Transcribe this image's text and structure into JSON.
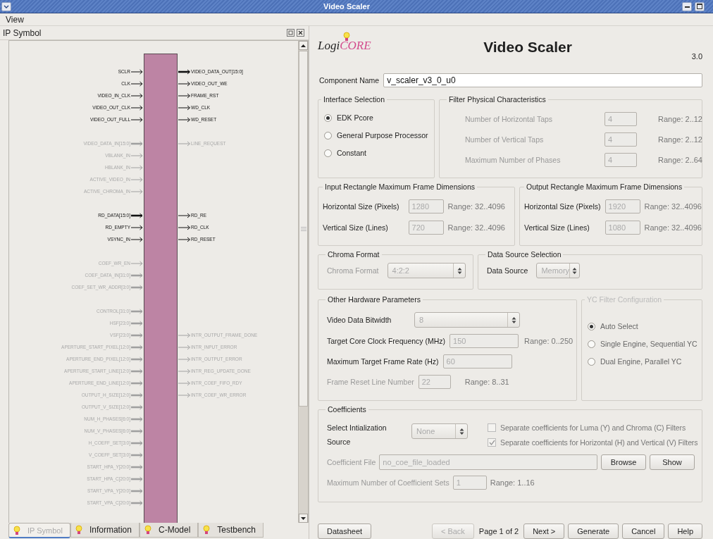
{
  "window": {
    "title": "Video Scaler"
  },
  "menu": [
    "View"
  ],
  "left_panel": {
    "title": "IP Symbol",
    "symbol": {
      "groups": [
        {
          "rows": [
            {
              "left": {
                "name": "SCLR",
                "enabled": true,
                "bus": false
              },
              "right": {
                "name": "VIDEO_DATA_OUT[15:0]",
                "enabled": true,
                "bus": true
              }
            },
            {
              "left": {
                "name": "CLK",
                "enabled": true,
                "bus": false
              },
              "right": {
                "name": "VIDEO_OUT_WE",
                "enabled": true,
                "bus": false
              }
            },
            {
              "left": {
                "name": "VIDEO_IN_CLK",
                "enabled": true,
                "bus": false
              },
              "right": {
                "name": "FRAME_RST",
                "enabled": true,
                "bus": false
              }
            },
            {
              "left": {
                "name": "VIDEO_OUT_CLK",
                "enabled": true,
                "bus": false
              },
              "right": {
                "name": "WD_CLK",
                "enabled": true,
                "bus": false
              }
            },
            {
              "left": {
                "name": "VIDEO_OUT_FULL",
                "enabled": true,
                "bus": false
              },
              "right": {
                "name": "WD_RESET",
                "enabled": true,
                "bus": false
              }
            }
          ]
        },
        {
          "rows": [
            {
              "left": {
                "name": "VIDEO_DATA_IN[15:0]",
                "enabled": false,
                "bus": true
              },
              "right": {
                "name": "LINE_REQUEST",
                "enabled": false,
                "bus": false
              }
            },
            {
              "left": {
                "name": "VBLANK_IN",
                "enabled": false,
                "bus": false
              }
            },
            {
              "left": {
                "name": "HBLANK_IN",
                "enabled": false,
                "bus": false
              }
            },
            {
              "left": {
                "name": "ACTIVE_VIDEO_IN",
                "enabled": false,
                "bus": false
              }
            },
            {
              "left": {
                "name": "ACTIVE_CHROMA_IN",
                "enabled": false,
                "bus": false
              }
            }
          ]
        },
        {
          "rows": [
            {
              "left": {
                "name": "RD_DATA[15:0]",
                "enabled": true,
                "bus": true
              },
              "right": {
                "name": "RD_RE",
                "enabled": true,
                "bus": false
              }
            },
            {
              "left": {
                "name": "RD_EMPTY",
                "enabled": true,
                "bus": false
              },
              "right": {
                "name": "RD_CLK",
                "enabled": true,
                "bus": false
              }
            },
            {
              "left": {
                "name": "VSYNC_IN",
                "enabled": true,
                "bus": false
              },
              "right": {
                "name": "RD_RESET",
                "enabled": true,
                "bus": false
              }
            }
          ]
        },
        {
          "rows": [
            {
              "left": {
                "name": "COEF_WR_EN",
                "enabled": false,
                "bus": false
              }
            },
            {
              "left": {
                "name": "COEF_DATA_IN[31:0]",
                "enabled": false,
                "bus": true
              }
            },
            {
              "left": {
                "name": "COEF_SET_WR_ADDR[3:0]",
                "enabled": false,
                "bus": true
              }
            }
          ]
        },
        {
          "rows": [
            {
              "left": {
                "name": "CONTROL[31:0]",
                "enabled": false,
                "bus": true
              }
            },
            {
              "left": {
                "name": "HSF[23:0]",
                "enabled": false,
                "bus": true
              }
            },
            {
              "left": {
                "name": "VSF[23:0]",
                "enabled": false,
                "bus": true
              },
              "right": {
                "name": "INTR_OUTPUT_FRAME_DONE",
                "enabled": false,
                "bus": false
              }
            },
            {
              "left": {
                "name": "APERTURE_START_PIXEL[12:0]",
                "enabled": false,
                "bus": true
              },
              "right": {
                "name": "INTR_INPUT_ERROR",
                "enabled": false,
                "bus": false
              }
            },
            {
              "left": {
                "name": "APERTURE_END_PIXEL[12:0]",
                "enabled": false,
                "bus": true
              },
              "right": {
                "name": "INTR_OUTPUT_ERROR",
                "enabled": false,
                "bus": false
              }
            },
            {
              "left": {
                "name": "APERTURE_START_LINE[12:0]",
                "enabled": false,
                "bus": true
              },
              "right": {
                "name": "INTR_REG_UPDATE_DONE",
                "enabled": false,
                "bus": false
              }
            },
            {
              "left": {
                "name": "APERTURE_END_LINE[12:0]",
                "enabled": false,
                "bus": true
              },
              "right": {
                "name": "INTR_COEF_FIFO_RDY",
                "enabled": false,
                "bus": false
              }
            },
            {
              "left": {
                "name": "OUTPUT_H_SIZE[12:0]",
                "enabled": false,
                "bus": true
              },
              "right": {
                "name": "INTR_COEF_WR_ERROR",
                "enabled": false,
                "bus": false
              }
            },
            {
              "left": {
                "name": "OUTPUT_V_SIZE[12:0]",
                "enabled": false,
                "bus": true
              }
            },
            {
              "left": {
                "name": "NUM_H_PHASES[6:0]",
                "enabled": false,
                "bus": true
              }
            },
            {
              "left": {
                "name": "NUM_V_PHASES[6:0]",
                "enabled": false,
                "bus": true
              }
            },
            {
              "left": {
                "name": "H_COEFF_SET[3:0]",
                "enabled": false,
                "bus": true
              }
            },
            {
              "left": {
                "name": "V_COEFF_SET[3:0]",
                "enabled": false,
                "bus": true
              }
            },
            {
              "left": {
                "name": "START_HPA_Y[20:0]",
                "enabled": false,
                "bus": true
              }
            },
            {
              "left": {
                "name": "START_HPA_C[20:0]",
                "enabled": false,
                "bus": true
              }
            },
            {
              "left": {
                "name": "START_VPA_Y[20:0]",
                "enabled": false,
                "bus": true
              }
            },
            {
              "left": {
                "name": "START_VPA_C[20:0]",
                "enabled": false,
                "bus": true
              }
            }
          ]
        }
      ]
    },
    "tabs": [
      {
        "label": "IP Symbol",
        "selected": true
      },
      {
        "label": "Information",
        "selected": false
      },
      {
        "label": "C-Model",
        "selected": false
      },
      {
        "label": "Testbench",
        "selected": false
      }
    ]
  },
  "header": {
    "logo": {
      "prefix": "Logi",
      "suffix": "CORE"
    },
    "title": "Video Scaler",
    "version": "3.0"
  },
  "component_name": {
    "label": "Component Name",
    "value": "v_scaler_v3_0_u0"
  },
  "interface_selection": {
    "title": "Interface Selection",
    "options": [
      {
        "label": "EDK Pcore",
        "selected": true
      },
      {
        "label": "General Purpose Processor",
        "selected": false
      },
      {
        "label": "Constant",
        "selected": false
      }
    ]
  },
  "filter": {
    "title": "Filter Physical Characteristics",
    "fields": [
      {
        "label": "Number of Horizontal Taps",
        "value": "4",
        "range": "Range: 2..12",
        "disabled": true
      },
      {
        "label": "Number of Vertical Taps",
        "value": "4",
        "range": "Range: 2..12",
        "disabled": true
      },
      {
        "label": "Maximum Number of Phases",
        "value": "4",
        "range": "Range: 2..64",
        "disabled": true
      }
    ]
  },
  "input_rect": {
    "title": "Input Rectangle Maximum Frame Dimensions",
    "fields": [
      {
        "label": "Horizontal Size (Pixels)",
        "value": "1280",
        "range": "Range: 32..4096",
        "disabled": false
      },
      {
        "label": "Vertical Size (Lines)",
        "value": "720",
        "range": "Range: 32..4096",
        "disabled": false
      }
    ]
  },
  "output_rect": {
    "title": "Output Rectangle Maximum Frame Dimensions",
    "fields": [
      {
        "label": "Horizontal Size (Pixels)",
        "value": "1920",
        "range": "Range: 32..4096",
        "disabled": false
      },
      {
        "label": "Vertical Size (Lines)",
        "value": "1080",
        "range": "Range: 32..4096",
        "disabled": false
      }
    ]
  },
  "chroma": {
    "title": "Chroma Format",
    "fields": [
      {
        "kind": "select",
        "label": "Chroma Format",
        "value": "4:2:2",
        "disabled": true
      }
    ]
  },
  "data_source": {
    "title": "Data Source Selection",
    "fields": [
      {
        "kind": "select",
        "label": "Data Source",
        "value": "Memory",
        "disabled": false
      }
    ]
  },
  "hardware": {
    "title": "Other Hardware Parameters",
    "fields": [
      {
        "kind": "select",
        "label": "Video Data Bitwidth",
        "value": "8",
        "disabled": false
      },
      {
        "kind": "text",
        "label": "Target Core Clock Frequency (MHz)",
        "value": "150",
        "range": "Range: 0..250",
        "disabled": false
      },
      {
        "kind": "text",
        "label": "Maximum Target Frame Rate (Hz)",
        "value": "60",
        "disabled": false
      },
      {
        "kind": "text",
        "label": "Frame Reset Line Number",
        "value": "22",
        "range": "Range: 8..31",
        "disabled": true
      }
    ]
  },
  "yc_filter": {
    "title": "YC Filter Configuration",
    "disabled": true,
    "options": [
      {
        "label": "Auto Select",
        "selected": true
      },
      {
        "label": "Single Engine, Sequential YC",
        "selected": false
      },
      {
        "label": "Dual Engine, Parallel YC",
        "selected": false
      }
    ]
  },
  "coefficients": {
    "title": "Coefficients",
    "init_source": {
      "label": "Select Intialization Source",
      "value": "None"
    },
    "checkboxes": [
      {
        "label": "Separate coefficients for Luma (Y) and Chroma (C) Filters",
        "checked": false
      },
      {
        "label": "Separate coefficients for Horizontal (H) and Vertical (V) Filters",
        "checked": true
      }
    ],
    "file": {
      "label": "Coefficient File",
      "value": "no_coe_file_loaded",
      "buttons": [
        "Browse",
        "Show"
      ]
    },
    "max_sets": {
      "label": "Maximum Number of Coefficient Sets",
      "value": "1",
      "range": "Range: 1..16"
    }
  },
  "footer": {
    "items": [
      {
        "kind": "button",
        "label": "Datasheet",
        "disabled": false
      },
      {
        "kind": "spacer"
      },
      {
        "kind": "button",
        "label": "< Back",
        "disabled": true
      },
      {
        "kind": "text",
        "label": "Page 1 of 2"
      },
      {
        "kind": "button",
        "label": "Next >",
        "disabled": false
      },
      {
        "kind": "button",
        "label": "Generate",
        "disabled": false
      },
      {
        "kind": "button",
        "label": "Cancel",
        "disabled": false
      },
      {
        "kind": "button",
        "label": "Help",
        "disabled": false
      }
    ]
  }
}
